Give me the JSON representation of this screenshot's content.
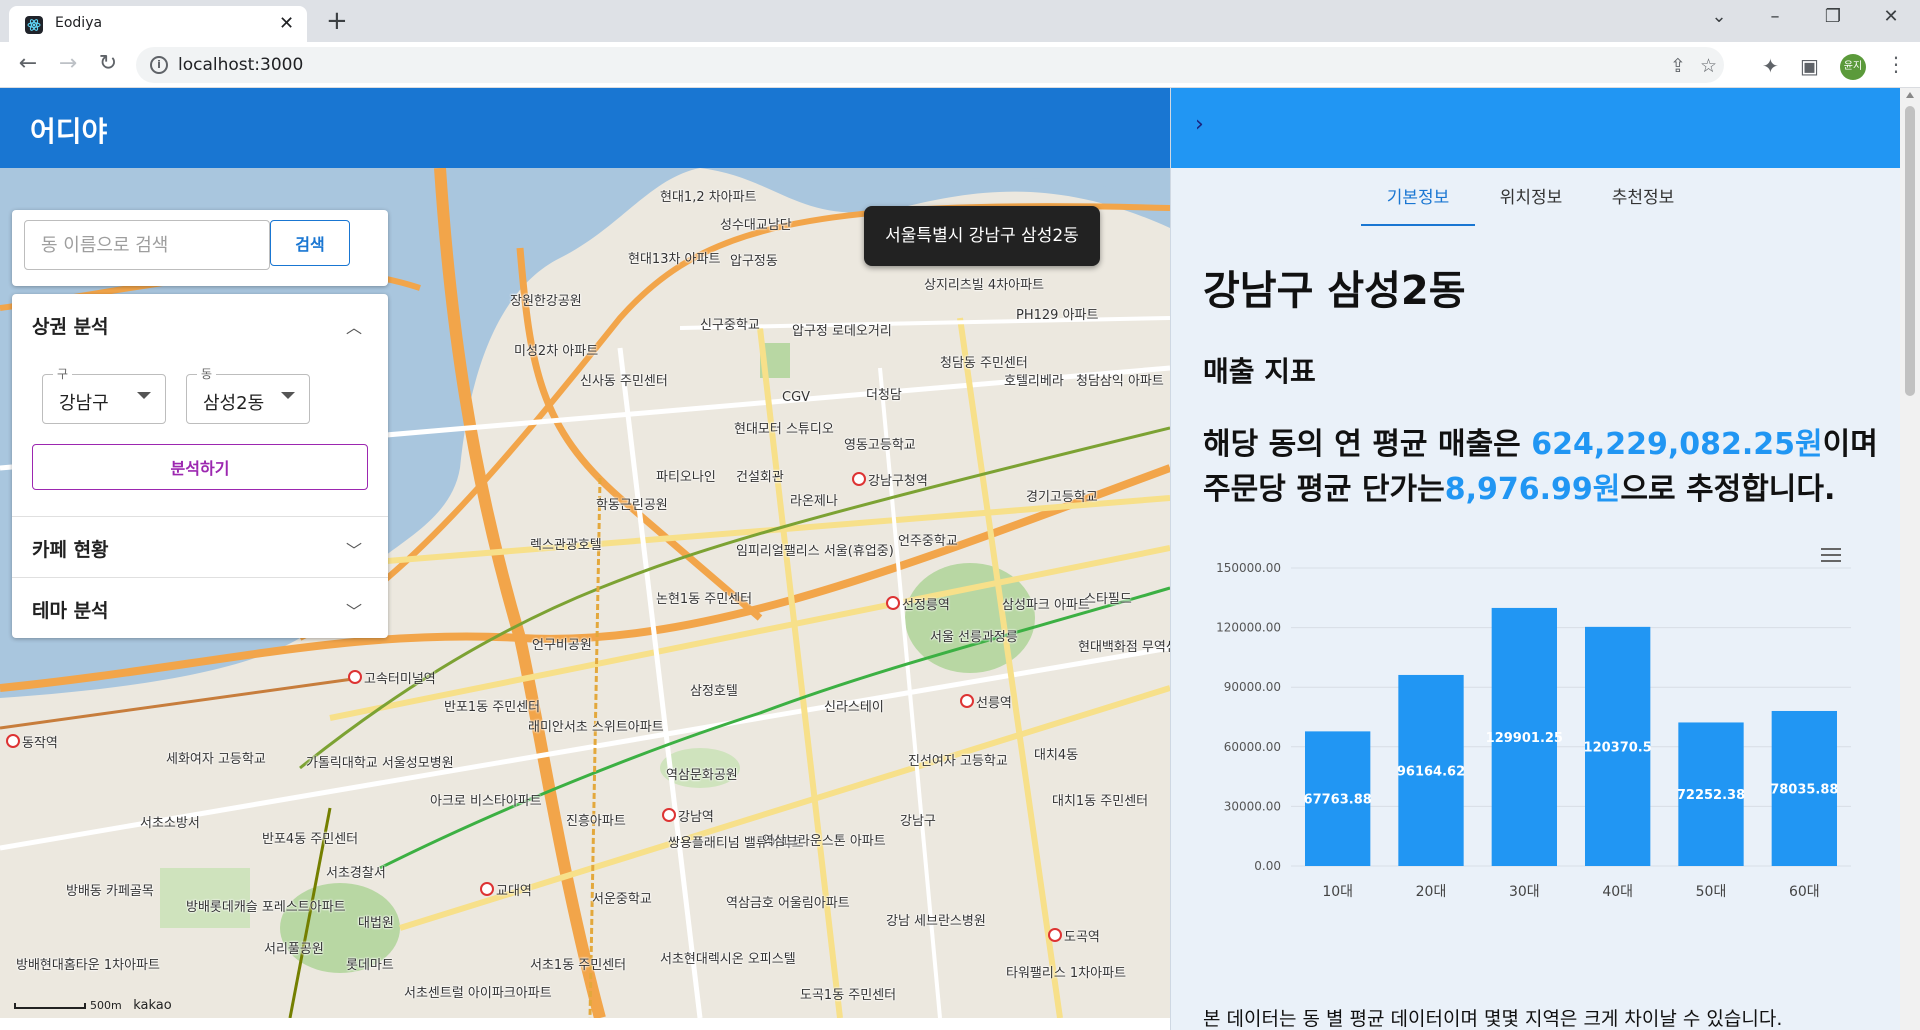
{
  "browser": {
    "tab_title": "Eodiya",
    "url": "localhost:3000",
    "profile_label": "윤지"
  },
  "app": {
    "title": "어디야"
  },
  "search": {
    "placeholder": "동 이름으로 검색",
    "button_label": "검색"
  },
  "accordion": {
    "sections": [
      {
        "title": "상권 분석",
        "expanded": true
      },
      {
        "title": "카페 현황",
        "expanded": false
      },
      {
        "title": "테마 분석",
        "expanded": false
      }
    ],
    "gu_label": "구",
    "gu_value": "강남구",
    "dong_label": "동",
    "dong_value": "삼성2동",
    "analyze_label": "분석하기"
  },
  "map": {
    "tooltip": "서울특별시 강남구 삼성2동",
    "scale_label": "500m",
    "attribution": "kakao",
    "labels": [
      "현대1,2 차아파트",
      "성수대교남단",
      "현대13차 아파트",
      "압구정동",
      "상지리츠빌 4차아파트",
      "PH129 아파트",
      "장원한강공원",
      "신구중학교",
      "압구정 로데오거리",
      "청담동 주민센터",
      "호텔리베라",
      "청담삼익 아파트",
      "미성2차 아파트",
      "신사동 주민센터",
      "CGV",
      "더청담",
      "현대모터 스튜디오",
      "영동고등학교",
      "파티오나인",
      "건설회관",
      "라온제나",
      "강남구청역",
      "경기고등학교",
      "학동근린공원",
      "렉스관광호텔",
      "임피리얼팰리스 서울(휴업중)",
      "언주중학교",
      "논현1동 주민센터",
      "선정릉역",
      "삼성파크 아파트",
      "스타필드",
      "언구비공원",
      "서울 선릉과정릉",
      "현대백화점 무역센터점",
      "반포1동 주민센터",
      "삼정호텔",
      "신라스테이",
      "선릉역",
      "래미안서초 스위트아파트",
      "역삼문화공원",
      "진선여자 고등학교",
      "대치1동 주민센터",
      "아크로 비스타아파트",
      "진흥아파트",
      "강남역",
      "쌍용플래티넘 밸류아파트",
      "역삼브라운스톤 아파트",
      "강남구",
      "대치4동",
      "서초소방서",
      "반포4동 주민센터",
      "서초경찰서",
      "교대역",
      "서운중학교",
      "역삼금호 어울림아파트",
      "강남 세브란스병원",
      "도곡역",
      "방배롯데캐슬 포레스트아파트",
      "대법원",
      "서리풀공원",
      "롯데마트",
      "서초1동 주민센터",
      "서초현대렉시온 오피스텔",
      "도곡1동 주민센터",
      "타워팰리스 1차아파트",
      "서초센트럴 아이파크아파트",
      "방배현대홈타운 1차아파트",
      "가톨릭대학교 서울성모병원",
      "고속터미널역",
      "세화여자 고등학교",
      "동작역",
      "방배동 카페골목"
    ]
  },
  "panel": {
    "tabs": [
      "기본정보",
      "위치정보",
      "추천정보"
    ],
    "active_tab": 0,
    "dong_title": "강남구 삼성2동",
    "section_title": "매출 지표",
    "summary_prefix": "해당 동의 연 평균 매출은 ",
    "summary_sales": "624,229,082.25원",
    "summary_mid": "이며 주문당 평균 단가는",
    "summary_price": "8,976.99원",
    "summary_suffix": "으로 추정합니다.",
    "footnote": "본 데이터는 동 별 평균 데이터이며 몇몇 지역은 크게 차이날 수 있습니다."
  },
  "chart_data": {
    "type": "bar",
    "categories": [
      "10대",
      "20대",
      "30대",
      "40대",
      "50대",
      "60대"
    ],
    "values": [
      67763.88,
      96164.62,
      129901.25,
      120370.5,
      72252.38,
      78035.88
    ],
    "value_labels": [
      "67763.88",
      "96164.62",
      "129901.25",
      "120370.5",
      "72252.38",
      "78035.88"
    ],
    "y_ticks": [
      "0.00",
      "30000.00",
      "60000.00",
      "90000.00",
      "120000.00",
      "150000.00"
    ],
    "ylim": [
      0,
      150000
    ],
    "bar_color": "#2196f3",
    "grid": true,
    "title": "",
    "xlabel": "",
    "ylabel": ""
  }
}
